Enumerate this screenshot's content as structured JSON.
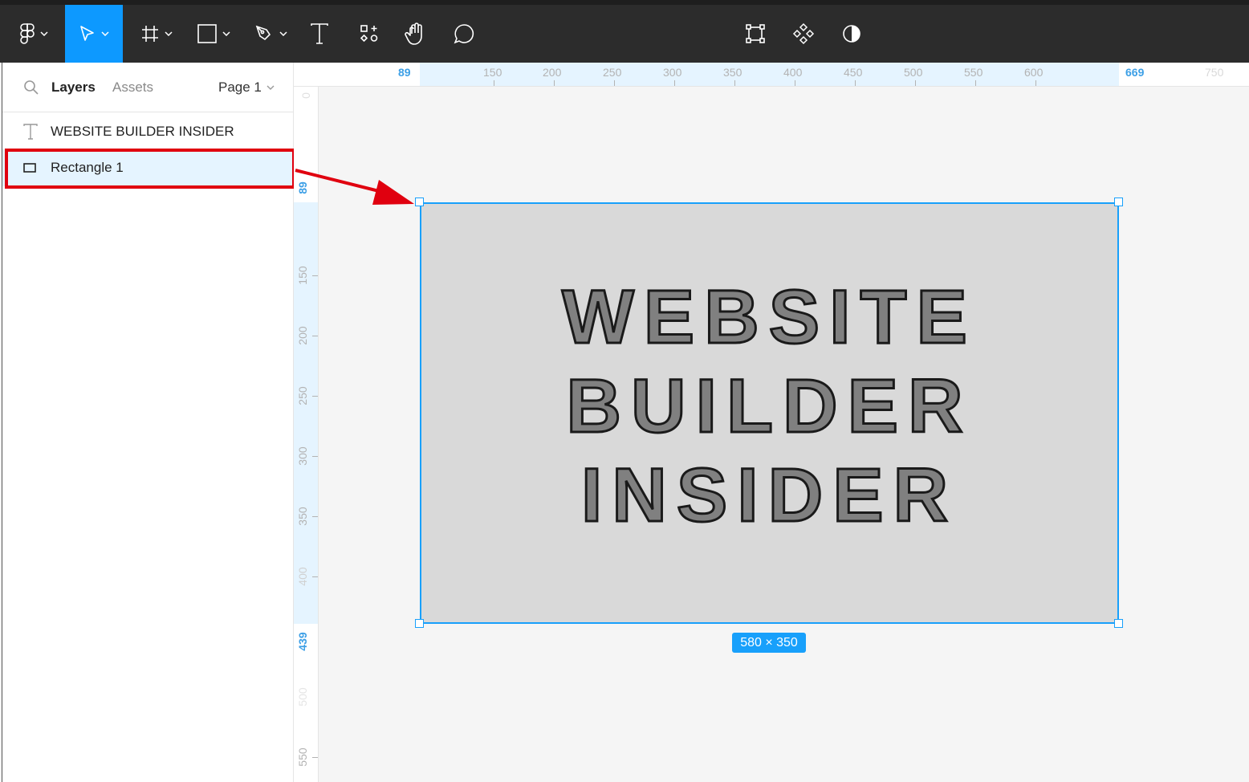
{
  "toolbar": {
    "tools": [
      {
        "name": "main-menu",
        "icon": "figma-logo-icon"
      },
      {
        "name": "move",
        "icon": "move-arrow-icon",
        "active": true
      },
      {
        "name": "frame",
        "icon": "frame-hash-icon"
      },
      {
        "name": "shape",
        "icon": "rectangle-icon"
      },
      {
        "name": "pen",
        "icon": "pen-icon"
      },
      {
        "name": "text",
        "icon": "text-icon"
      },
      {
        "name": "resources",
        "icon": "resources-icon"
      },
      {
        "name": "hand",
        "icon": "hand-icon"
      },
      {
        "name": "comment",
        "icon": "comment-icon"
      }
    ],
    "center_tools": [
      "transform-icon",
      "component-icon",
      "contrast-icon"
    ],
    "accent_color": "#0d99ff"
  },
  "left_panel": {
    "tabs": {
      "layers": "Layers",
      "assets": "Assets"
    },
    "page_select": "Page 1",
    "layers": [
      {
        "label": "WEBSITE BUILDER INSIDER",
        "icon": "text-layer-icon"
      },
      {
        "label": "Rectangle 1",
        "icon": "rectangle-layer-icon",
        "selected": true
      }
    ]
  },
  "rulers": {
    "top": {
      "start": "89",
      "end": "669",
      "ticks": [
        "150",
        "200",
        "250",
        "300",
        "350",
        "400",
        "450",
        "500",
        "550",
        "600",
        "750"
      ]
    },
    "left": {
      "start": "89",
      "end": "439",
      "ticks": [
        "0",
        "150",
        "200",
        "250",
        "300",
        "350",
        "400",
        "500",
        "550"
      ]
    }
  },
  "canvas": {
    "text_lines": [
      "WEBSITE",
      "BUILDER",
      "INSIDER"
    ],
    "dimension_label": "580 × 350",
    "selection_color": "#18a0fb",
    "rect_fill": "#d9d9d9",
    "annotation_color": "#e0000f"
  }
}
